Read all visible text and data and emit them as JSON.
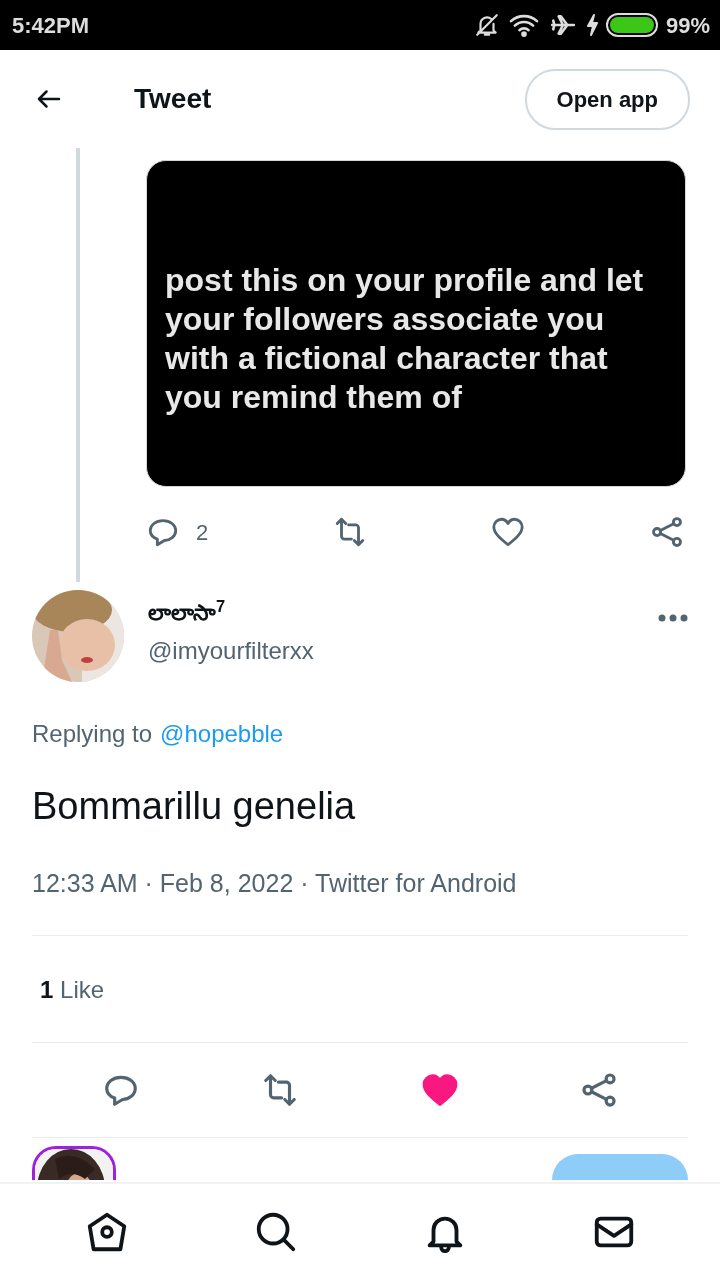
{
  "status_bar": {
    "time": "5:42PM",
    "battery": "99%"
  },
  "header": {
    "title": "Tweet",
    "button": "Open app"
  },
  "parent_tweet": {
    "media_text": "post this on your profile and let your followers associate you with a fictional character that you remind them of",
    "actions": [
      {
        "kind": "reply",
        "count": "2",
        "liked": false
      },
      {
        "kind": "retweet",
        "liked": false
      },
      {
        "kind": "like",
        "liked": false
      },
      {
        "kind": "share",
        "liked": false
      }
    ]
  },
  "tweet": {
    "name": "లాలాసా$^{7}$",
    "handle": "@imyourfilterxx",
    "replying_label": "Replying to",
    "replying_to": "@hopebble",
    "text": "Bommarillu genelia",
    "meta": "12:33 AM · Feb 8, 2022 · Twitter for Android",
    "stats": [
      {
        "count": "1",
        "label": "Like"
      }
    ],
    "actions": [
      {
        "kind": "reply",
        "liked": false
      },
      {
        "kind": "retweet",
        "liked": false
      },
      {
        "kind": "like",
        "liked": true
      },
      {
        "kind": "share",
        "liked": false
      }
    ]
  },
  "bottom_nav": [
    {
      "kind": "home"
    },
    {
      "kind": "search"
    },
    {
      "kind": "notifications"
    },
    {
      "kind": "messages"
    }
  ]
}
